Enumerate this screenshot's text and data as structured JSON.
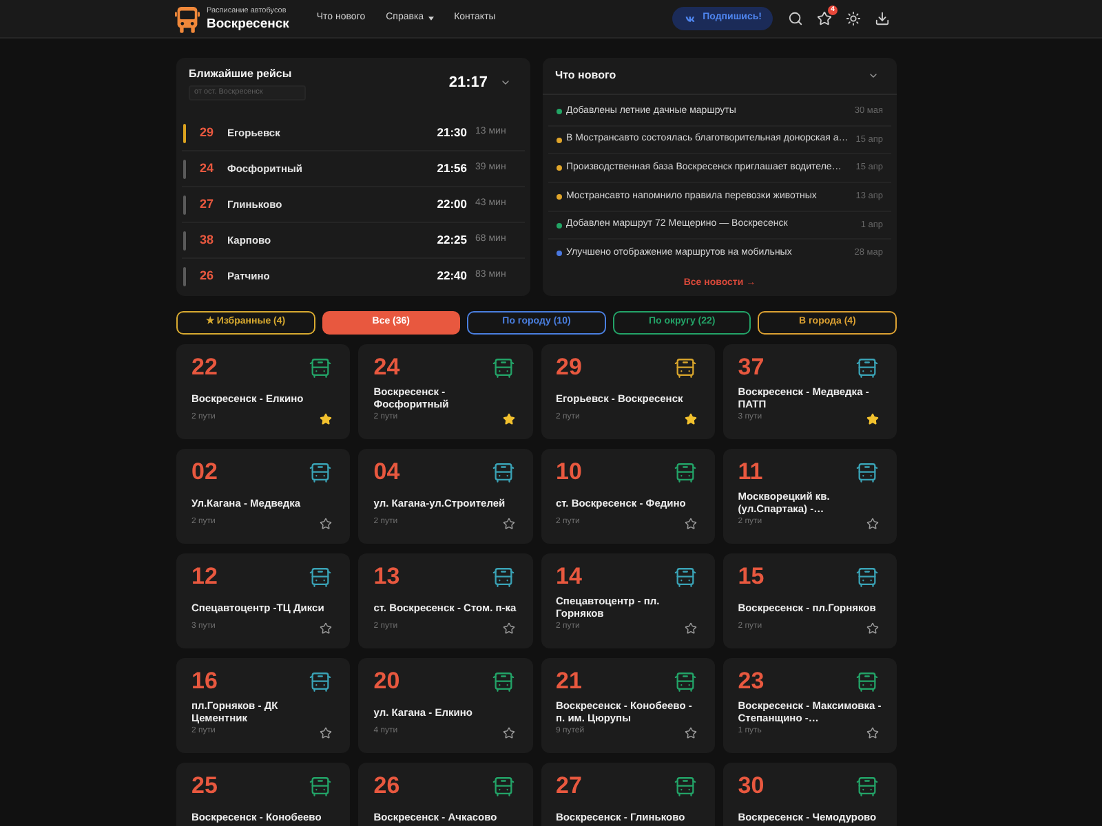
{
  "header": {
    "logo_subtitle": "Расписание автобусов",
    "logo_title": "Воскресенск",
    "nav": [
      {
        "label": "Что нового",
        "has_menu": false
      },
      {
        "label": "Справка",
        "has_menu": true
      },
      {
        "label": "Контакты",
        "has_menu": false
      }
    ],
    "subscribe_button": "Подпишись!",
    "favorites_badge": "4"
  },
  "departures": {
    "title": "Ближайшие рейсы",
    "stop_field": {
      "value": "от ост. Воскресенск"
    },
    "clock": "21:17",
    "rows": [
      {
        "route": "29",
        "destination": "Егорьевск",
        "time": "21:30",
        "wait": "13 мин",
        "highlighted": true
      },
      {
        "route": "24",
        "destination": "Фосфоритный",
        "time": "21:56",
        "wait": "39 мин",
        "highlighted": false
      },
      {
        "route": "27",
        "destination": "Глиньково",
        "time": "22:00",
        "wait": "43 мин",
        "highlighted": false
      },
      {
        "route": "38",
        "destination": "Карпово",
        "time": "22:25",
        "wait": "68 мин",
        "highlighted": false
      },
      {
        "route": "26",
        "destination": "Ратчино",
        "time": "22:40",
        "wait": "83 мин",
        "highlighted": false
      }
    ]
  },
  "news": {
    "title": "Что нового",
    "items": [
      {
        "text": "Добавлены летние дачные маршруты",
        "date": "30 мая",
        "color": "#22a565"
      },
      {
        "text": "В Мострансавто состоялась благотворительная донорская а…",
        "date": "15 апр",
        "color": "#e0a52a"
      },
      {
        "text": "Производственная база Воскресенск приглашает водителе…",
        "date": "15 апр",
        "color": "#e0a52a"
      },
      {
        "text": "Мострансавто напомнило правила перевозки животных",
        "date": "13 апр",
        "color": "#e0a52a"
      },
      {
        "text": "Добавлен маршрут 72 Мещерино — Воскресенск",
        "date": "1 апр",
        "color": "#22a565"
      },
      {
        "text": "Улучшено отображение маршрутов на мобильных",
        "date": "28 мар",
        "color": "#4a78e0"
      }
    ],
    "all_link": "Все новости →"
  },
  "filters": [
    {
      "label": "★ Избранные (4)",
      "color": "#d8aa30",
      "selected": false
    },
    {
      "label": "Все (36)",
      "color": "#e8583f",
      "selected": true
    },
    {
      "label": "По городу (10)",
      "color": "#4a7fe0",
      "selected": false
    },
    {
      "label": "По округу (22)",
      "color": "#23a468",
      "selected": false
    },
    {
      "label": "В города (4)",
      "color": "#dca132",
      "selected": false
    }
  ],
  "routes": [
    {
      "number": "22",
      "name": "Воскресенск - Елкино",
      "paths": "2 пути",
      "color": "#23a468",
      "favorite": true
    },
    {
      "number": "24",
      "name": "Воскресенск - Фосфоритный",
      "paths": "2 пути",
      "color": "#23a468",
      "favorite": true
    },
    {
      "number": "29",
      "name": "Егорьевск - Воскресенск",
      "paths": "2 пути",
      "color": "#d8a52c",
      "favorite": true
    },
    {
      "number": "37",
      "name": "Воскресенск - Медведка - ПАТП",
      "paths": "3 пути",
      "color": "#3aa3b6",
      "favorite": true
    },
    {
      "number": "02",
      "name": "Ул.Кагана - Медведка",
      "paths": "2 пути",
      "color": "#3aa3b6",
      "favorite": false
    },
    {
      "number": "04",
      "name": "ул. Кагана-ул.Строителей",
      "paths": "2 пути",
      "color": "#3aa3b6",
      "favorite": false
    },
    {
      "number": "10",
      "name": "ст. Воскресенск - Федино",
      "paths": "2 пути",
      "color": "#23a468",
      "favorite": false
    },
    {
      "number": "11",
      "name": "Москворецкий кв. (ул.Спартака) -…",
      "paths": "2 пути",
      "color": "#3aa3b6",
      "favorite": false
    },
    {
      "number": "12",
      "name": "Спецавтоцентр -ТЦ Дикси",
      "paths": "3 пути",
      "color": "#3aa3b6",
      "favorite": false
    },
    {
      "number": "13",
      "name": "ст. Воскресенск - Стом. п-ка",
      "paths": "2 пути",
      "color": "#3aa3b6",
      "favorite": false
    },
    {
      "number": "14",
      "name": "Спецавтоцентр - пл. Горняков",
      "paths": "2 пути",
      "color": "#3aa3b6",
      "favorite": false
    },
    {
      "number": "15",
      "name": "Воскресенск - пл.Горняков",
      "paths": "2 пути",
      "color": "#3aa3b6",
      "favorite": false
    },
    {
      "number": "16",
      "name": "пл.Горняков - ДК Цементник",
      "paths": "2 пути",
      "color": "#3aa3b6",
      "favorite": false
    },
    {
      "number": "20",
      "name": "ул. Кагана - Елкино",
      "paths": "4 пути",
      "color": "#23a468",
      "favorite": false
    },
    {
      "number": "21",
      "name": "Воскресенск - Конобеево - п. им. Цюрупы",
      "paths": "9 путей",
      "color": "#23a468",
      "favorite": false
    },
    {
      "number": "23",
      "name": "Воскресенск - Максимовка - Степанщино -…",
      "paths": "1 путь",
      "color": "#23a468",
      "favorite": false
    },
    {
      "number": "25",
      "name": "Воскресенск - Конобеево",
      "color": "#23a468"
    },
    {
      "number": "26",
      "name": "Воскресенск - Ачкасово",
      "color": "#23a468"
    },
    {
      "number": "27",
      "name": "Воскресенск - Глиньково",
      "color": "#23a468"
    },
    {
      "number": "30",
      "name": "Воскресенск - Чемодурово",
      "color": "#23a468"
    }
  ]
}
